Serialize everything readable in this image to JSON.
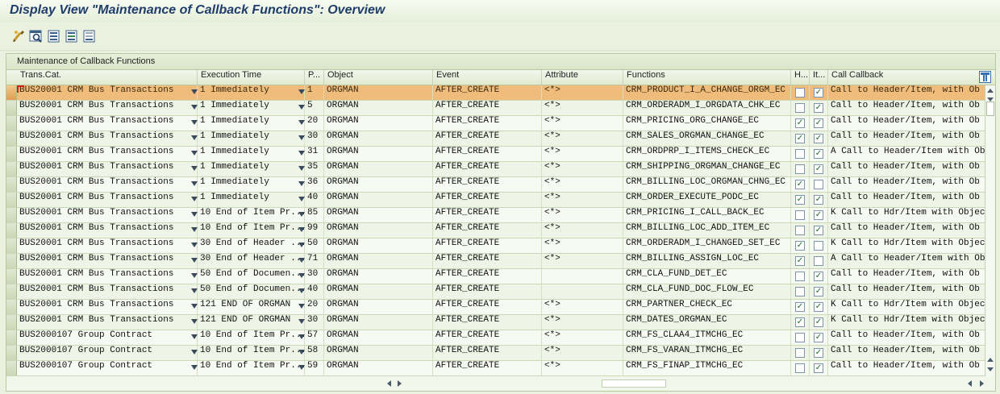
{
  "window": {
    "title": "Display View \"Maintenance of Callback Functions\": Overview"
  },
  "toolbar": {
    "buttons": [
      {
        "icon": "display-change-icon"
      },
      {
        "icon": "find-icon"
      },
      {
        "icon": "select-all-icon"
      },
      {
        "icon": "select-block-icon"
      },
      {
        "icon": "deselect-all-icon"
      }
    ]
  },
  "colors": {
    "accent": "#1f3d6b",
    "selected_row": "#efbc7b",
    "background": "#eaf2df"
  },
  "table": {
    "title": "Maintenance of Callback Functions",
    "columns": [
      "Trans.Cat.",
      "Execution Time",
      "P...",
      "Object",
      "Event",
      "Attribute",
      "Functions",
      "H...",
      "It...",
      "Call Callback"
    ],
    "rows": [
      {
        "trans": "BUS20001 CRM Bus Transactions",
        "exec": "1 Immediately",
        "p": "1",
        "object": "ORGMAN",
        "event": "AFTER_CREATE",
        "attr": "<*>",
        "func": "CRM_PRODUCT_I_A_CHANGE_ORGM_EC",
        "h": false,
        "it": true,
        "callback": "Call to Header/Item, with Ob"
      },
      {
        "trans": "BUS20001 CRM Bus Transactions",
        "exec": "1 Immediately",
        "p": "5",
        "object": "ORGMAN",
        "event": "AFTER_CREATE",
        "attr": "<*>",
        "func": "CRM_ORDERADM_I_ORGDATA_CHK_EC",
        "h": false,
        "it": true,
        "callback": "Call to Header/Item, with Ob"
      },
      {
        "trans": "BUS20001 CRM Bus Transactions",
        "exec": "1 Immediately",
        "p": "20",
        "object": "ORGMAN",
        "event": "AFTER_CREATE",
        "attr": "<*>",
        "func": "CRM_PRICING_ORG_CHANGE_EC",
        "h": true,
        "it": true,
        "callback": "Call to Header/Item, with Ob"
      },
      {
        "trans": "BUS20001 CRM Bus Transactions",
        "exec": "1 Immediately",
        "p": "30",
        "object": "ORGMAN",
        "event": "AFTER_CREATE",
        "attr": "<*>",
        "func": "CRM_SALES_ORGMAN_CHANGE_EC",
        "h": true,
        "it": true,
        "callback": "Call to Header/Item, with Ob"
      },
      {
        "trans": "BUS20001 CRM Bus Transactions",
        "exec": "1 Immediately",
        "p": "31",
        "object": "ORGMAN",
        "event": "AFTER_CREATE",
        "attr": "<*>",
        "func": "CRM_ORDPRP_I_ITEMS_CHECK_EC",
        "h": false,
        "it": true,
        "callback": "A Call to Header/Item with Ob"
      },
      {
        "trans": "BUS20001 CRM Bus Transactions",
        "exec": "1 Immediately",
        "p": "35",
        "object": "ORGMAN",
        "event": "AFTER_CREATE",
        "attr": "<*>",
        "func": "CRM_SHIPPING_ORGMAN_CHANGE_EC",
        "h": false,
        "it": true,
        "callback": "Call to Header/Item, with Ob"
      },
      {
        "trans": "BUS20001 CRM Bus Transactions",
        "exec": "1 Immediately",
        "p": "36",
        "object": "ORGMAN",
        "event": "AFTER_CREATE",
        "attr": "<*>",
        "func": "CRM_BILLING_LOC_ORGMAN_CHNG_EC",
        "h": true,
        "it": false,
        "callback": "Call to Header/Item, with Ob"
      },
      {
        "trans": "BUS20001 CRM Bus Transactions",
        "exec": "1 Immediately",
        "p": "40",
        "object": "ORGMAN",
        "event": "AFTER_CREATE",
        "attr": "<*>",
        "func": "CRM_ORDER_EXECUTE_PODC_EC",
        "h": true,
        "it": true,
        "callback": "Call to Header/Item, with Ob"
      },
      {
        "trans": "BUS20001 CRM Bus Transactions",
        "exec": "10 End of Item Pr...",
        "p": "85",
        "object": "ORGMAN",
        "event": "AFTER_CREATE",
        "attr": "<*>",
        "func": "CRM_PRICING_I_CALL_BACK_EC",
        "h": false,
        "it": true,
        "callback": "K Call to Hdr/Item with Objec"
      },
      {
        "trans": "BUS20001 CRM Bus Transactions",
        "exec": "10 End of Item Pr...",
        "p": "99",
        "object": "ORGMAN",
        "event": "AFTER_CREATE",
        "attr": "<*>",
        "func": "CRM_BILLING_LOC_ADD_ITEM_EC",
        "h": false,
        "it": true,
        "callback": "Call to Header/Item, with Ob"
      },
      {
        "trans": "BUS20001 CRM Bus Transactions",
        "exec": "30 End of Header ...",
        "p": "50",
        "object": "ORGMAN",
        "event": "AFTER_CREATE",
        "attr": "<*>",
        "func": "CRM_ORDERADM_I_CHANGED_SET_EC",
        "h": true,
        "it": false,
        "callback": "K Call to Hdr/Item with Objec"
      },
      {
        "trans": "BUS20001 CRM Bus Transactions",
        "exec": "30 End of Header ...",
        "p": "71",
        "object": "ORGMAN",
        "event": "AFTER_CREATE",
        "attr": "<*>",
        "func": "CRM_BILLING_ASSIGN_LOC_EC",
        "h": true,
        "it": false,
        "callback": "A Call to Header/Item with Ob"
      },
      {
        "trans": "BUS20001 CRM Bus Transactions",
        "exec": "50 End of Documen...",
        "p": "30",
        "object": "ORGMAN",
        "event": "AFTER_CREATE",
        "attr": "",
        "func": "CRM_CLA_FUND_DET_EC",
        "h": false,
        "it": true,
        "callback": "Call to Header/Item, with Ob"
      },
      {
        "trans": "BUS20001 CRM Bus Transactions",
        "exec": "50 End of Documen...",
        "p": "40",
        "object": "ORGMAN",
        "event": "AFTER_CREATE",
        "attr": "",
        "func": "CRM_CLA_FUND_DOC_FLOW_EC",
        "h": false,
        "it": true,
        "callback": "Call to Header/Item, with Ob"
      },
      {
        "trans": "BUS20001 CRM Bus Transactions",
        "exec": "121 END OF ORGMAN",
        "p": "20",
        "object": "ORGMAN",
        "event": "AFTER_CREATE",
        "attr": "<*>",
        "func": "CRM_PARTNER_CHECK_EC",
        "h": true,
        "it": true,
        "callback": "K Call to Hdr/Item with Objec"
      },
      {
        "trans": "BUS20001 CRM Bus Transactions",
        "exec": "121 END OF ORGMAN",
        "p": "30",
        "object": "ORGMAN",
        "event": "AFTER_CREATE",
        "attr": "<*>",
        "func": "CRM_DATES_ORGMAN_EC",
        "h": true,
        "it": true,
        "callback": "K Call to Hdr/Item with Objec"
      },
      {
        "trans": "BUS2000107 Group Contract",
        "exec": "10 End of Item Pr...",
        "p": "57",
        "object": "ORGMAN",
        "event": "AFTER_CREATE",
        "attr": "<*>",
        "func": "CRM_FS_CLAA4_ITMCHG_EC",
        "h": false,
        "it": true,
        "callback": "Call to Header/Item, with Ob"
      },
      {
        "trans": "BUS2000107 Group Contract",
        "exec": "10 End of Item Pr...",
        "p": "58",
        "object": "ORGMAN",
        "event": "AFTER_CREATE",
        "attr": "<*>",
        "func": "CRM_FS_VARAN_ITMCHG_EC",
        "h": false,
        "it": true,
        "callback": "Call to Header/Item, with Ob"
      },
      {
        "trans": "BUS2000107 Group Contract",
        "exec": "10 End of Item Pr...",
        "p": "59",
        "object": "ORGMAN",
        "event": "AFTER_CREATE",
        "attr": "<*>",
        "func": "CRM_FS_FINAP_ITMCHG_EC",
        "h": false,
        "it": true,
        "callback": "Call to Header/Item, with Ob"
      }
    ],
    "selected_row": 0
  }
}
